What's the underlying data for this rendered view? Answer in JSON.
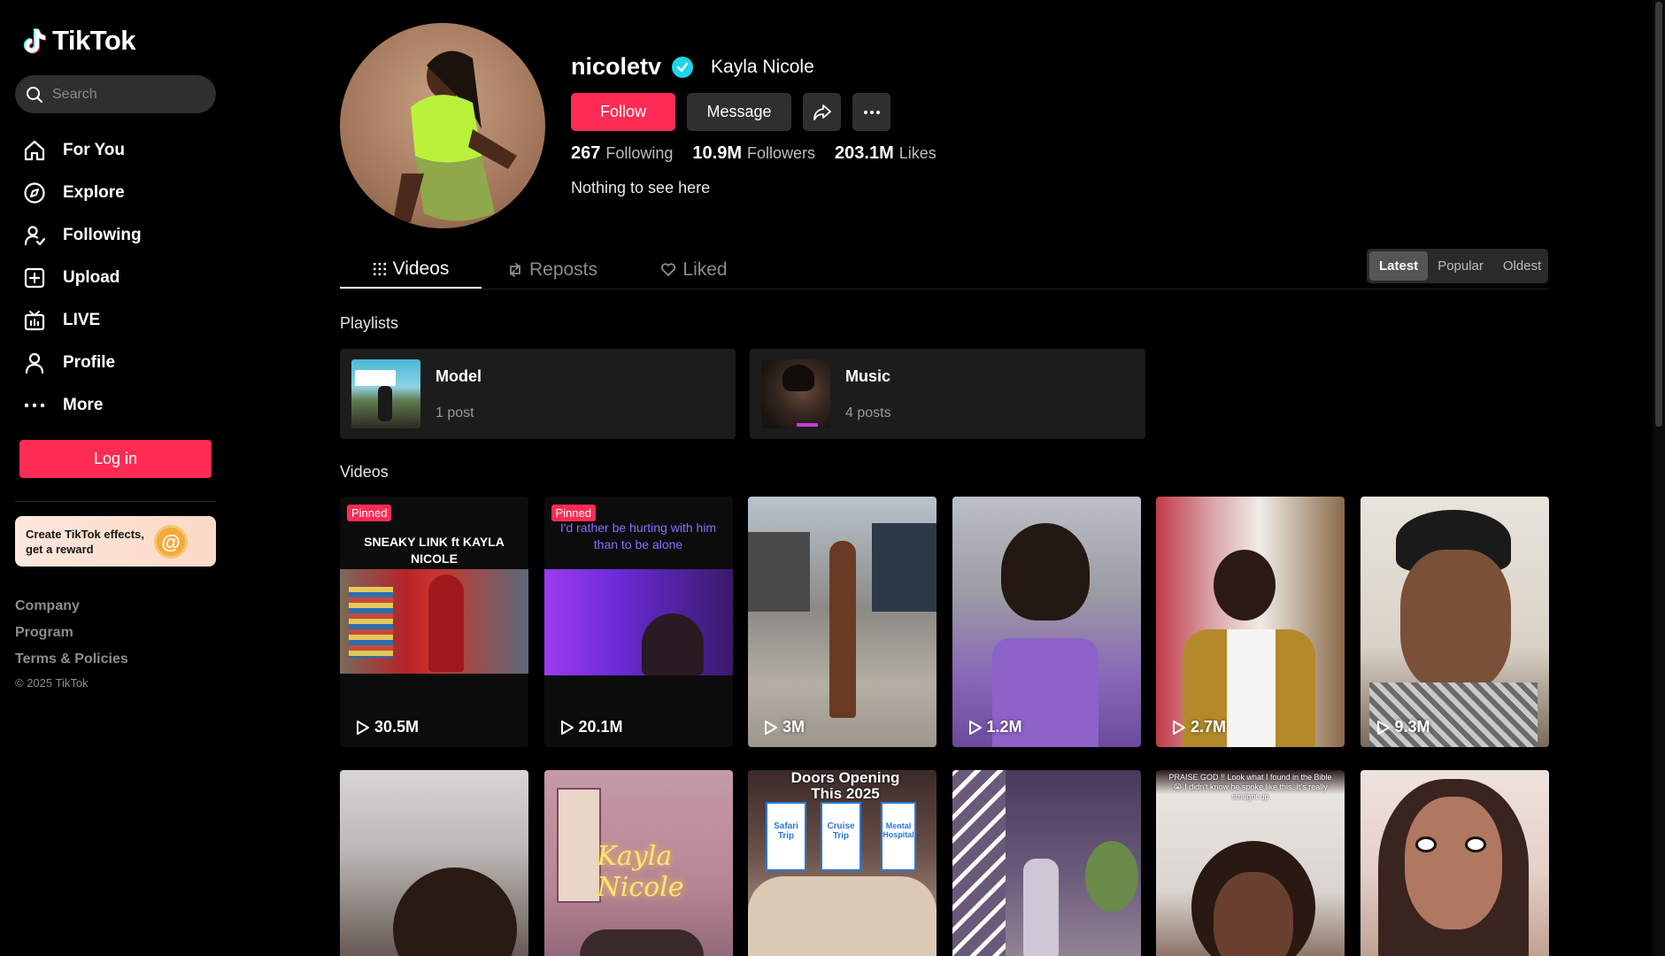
{
  "app": {
    "name": "TikTok"
  },
  "sidebar": {
    "search_placeholder": "Search",
    "nav": [
      {
        "label": "For You",
        "icon": "home-icon"
      },
      {
        "label": "Explore",
        "icon": "compass-icon"
      },
      {
        "label": "Following",
        "icon": "following-icon"
      },
      {
        "label": "Upload",
        "icon": "upload-icon"
      },
      {
        "label": "LIVE",
        "icon": "live-icon"
      },
      {
        "label": "Profile",
        "icon": "profile-icon"
      },
      {
        "label": "More",
        "icon": "more-dots-icon"
      }
    ],
    "login_label": "Log in",
    "promo": {
      "text": "Create TikTok effects, get a reward"
    },
    "footer": [
      "Company",
      "Program",
      "Terms & Policies"
    ],
    "copyright": "© 2025 TikTok"
  },
  "profile": {
    "username": "nicoletv",
    "display_name": "Kayla Nicole",
    "verified": true,
    "follow_label": "Follow",
    "message_label": "Message",
    "stats": {
      "following_count": "267",
      "following_label": "Following",
      "followers_count": "10.9M",
      "followers_label": "Followers",
      "likes_count": "203.1M",
      "likes_label": "Likes"
    },
    "bio": "Nothing to see here"
  },
  "tabs": [
    {
      "label": "Videos",
      "active": true
    },
    {
      "label": "Reposts",
      "active": false
    },
    {
      "label": "Liked",
      "active": false
    }
  ],
  "sort": [
    {
      "label": "Latest",
      "active": true
    },
    {
      "label": "Popular",
      "active": false
    },
    {
      "label": "Oldest",
      "active": false
    }
  ],
  "playlists_title": "Playlists",
  "playlists": [
    {
      "title": "Model",
      "count": "1 post"
    },
    {
      "title": "Music",
      "count": "4 posts"
    }
  ],
  "videos_title": "Videos",
  "videos": [
    {
      "pinned": "Pinned",
      "caption": "SNEAKY LINK ft KAYLA NICOLE",
      "views": "30.5M"
    },
    {
      "pinned": "Pinned",
      "caption": "I'd rather be hurting with him than to be alone",
      "views": "20.1M"
    },
    {
      "views": "3M"
    },
    {
      "views": "1.2M"
    },
    {
      "views": "2.7M"
    },
    {
      "views": "9.3M"
    },
    {},
    {
      "overlay_text": "Kayla Nicole"
    },
    {
      "overlay_text": "Doors Opening This 2025",
      "doors": [
        "Safari Trip",
        "Cruise Trip",
        "Mental Hospital"
      ]
    },
    {},
    {
      "overlay_text": "PRAISE GOD !! Look what I found in the Bible 😭 I didn't know he spoke like this. It's really straight up"
    },
    {}
  ],
  "colors": {
    "accent": "#fe2c55",
    "verified": "#20d5ec",
    "background": "#000000"
  }
}
